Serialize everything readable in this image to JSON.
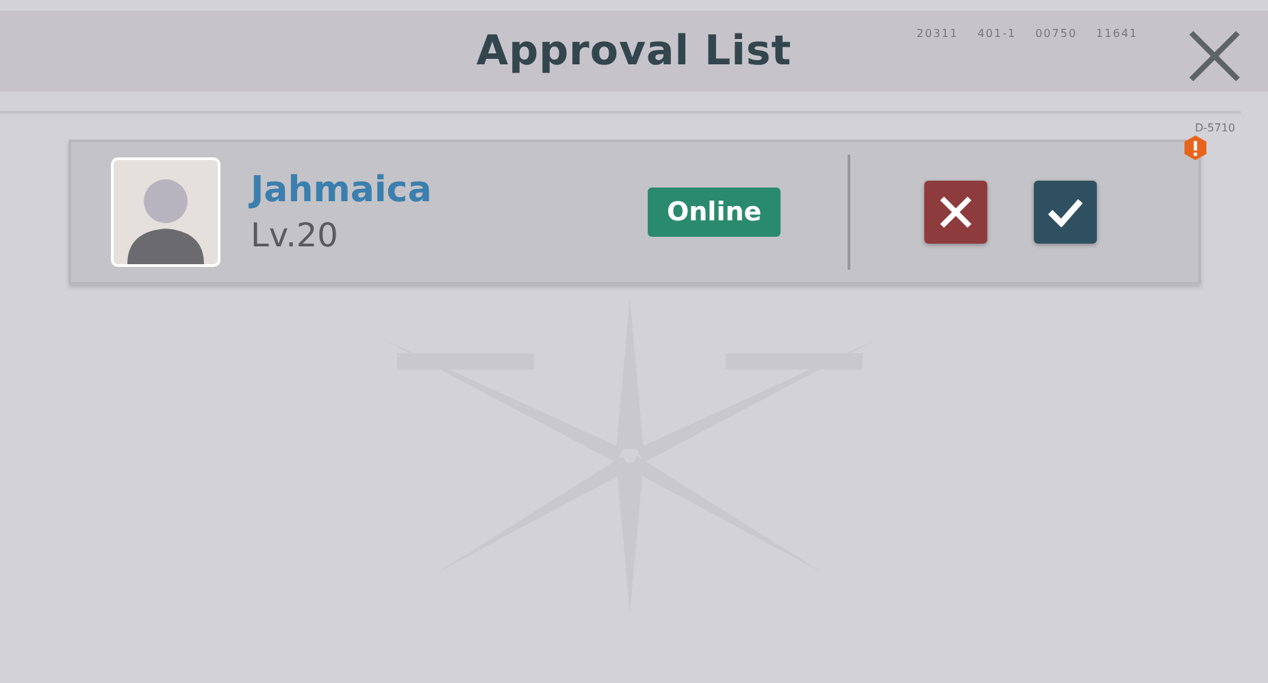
{
  "header": {
    "title": "Approval List",
    "codes": [
      "20311",
      "401-1",
      "00750",
      "11641"
    ]
  },
  "list_code": "D-5710",
  "requests": [
    {
      "name": "Jahmaica",
      "level": "Lv.20",
      "status": "Online",
      "alert": true
    }
  ]
}
